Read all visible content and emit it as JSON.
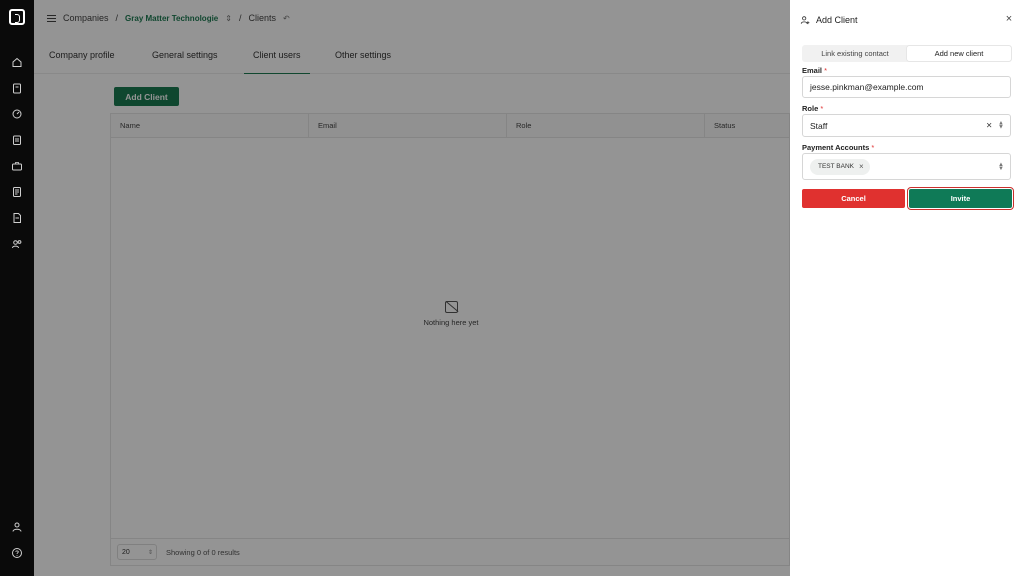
{
  "breadcrumb": {
    "companies": "Companies",
    "sep1": "/",
    "company": "Gray Matter Technologie",
    "sep2": "/",
    "current": "Clients"
  },
  "tabs": [
    {
      "label": "Company profile"
    },
    {
      "label": "General settings"
    },
    {
      "label": "Client users",
      "active": true
    },
    {
      "label": "Other settings"
    }
  ],
  "main": {
    "add_client_label": "Add Client",
    "columns": [
      "Name",
      "Email",
      "Role",
      "Status"
    ],
    "empty_text": "Nothing here yet",
    "page_size": "20",
    "showing_text": "Showing 0 of 0 results"
  },
  "drawer": {
    "title": "Add Client",
    "segment": {
      "link_existing": "Link existing contact",
      "add_new": "Add new client",
      "selected": "Add new client"
    },
    "email": {
      "label": "Email",
      "required": "*",
      "value": "jesse.pinkman@example.com"
    },
    "role": {
      "label": "Role",
      "required": "*",
      "value": "Staff"
    },
    "payment_accounts": {
      "label": "Payment Accounts",
      "required": "*",
      "selected": [
        "TEST BANK"
      ]
    },
    "cancel_label": "Cancel",
    "invite_label": "Invite"
  },
  "colors": {
    "brand_green": "#1b7a52",
    "cancel_red": "#e0312f",
    "rail": "#0a0a0a"
  },
  "icons": {
    "rail": [
      "home-icon",
      "clipboard-icon",
      "gauge-icon",
      "document-icon",
      "briefcase-icon",
      "ledger-icon",
      "file-icon",
      "users-icon",
      "user-icon",
      "help-icon"
    ]
  }
}
